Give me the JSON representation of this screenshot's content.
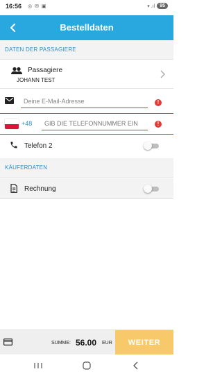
{
  "status_bar": {
    "time": "16:56",
    "app_icons": "◎ ✉ ▣",
    "signal": "▾ .ıl",
    "battery": "95"
  },
  "app_bar": {
    "title": "Bestelldaten",
    "back_icon": "chevron-left-icon",
    "color": "#29a8e0"
  },
  "passengers_section": {
    "header": "DATEN DER PASSAGIERE",
    "passenger": {
      "label": "Passagiere",
      "name": "JOHANN TEST",
      "icon": "people-icon"
    },
    "email": {
      "value": "",
      "placeholder": "Deine E-Mail-Adresse",
      "icon": "mail-icon",
      "error": true
    },
    "phone": {
      "country_flag": "Poland",
      "prefix": "+48",
      "value": "",
      "placeholder": "GIB DIE TELEFONNUMMER EIN",
      "error": true
    },
    "telefon2": {
      "label": "Telefon 2",
      "icon": "phone-icon",
      "enabled": false
    }
  },
  "buyer_section": {
    "header": "KÄUFERDATEN",
    "rechnung": {
      "label": "Rechnung",
      "icon": "document-icon",
      "enabled": false
    }
  },
  "bottom_bar": {
    "summe_label": "SUMME:",
    "summe_value": "56.00",
    "currency": "EUR",
    "weiter_label": "WEITER",
    "weiter_color": "#f8c96a"
  },
  "colors": {
    "accent": "#29a8e0",
    "error": "#e53935",
    "section_text": "#2b8fd0"
  }
}
